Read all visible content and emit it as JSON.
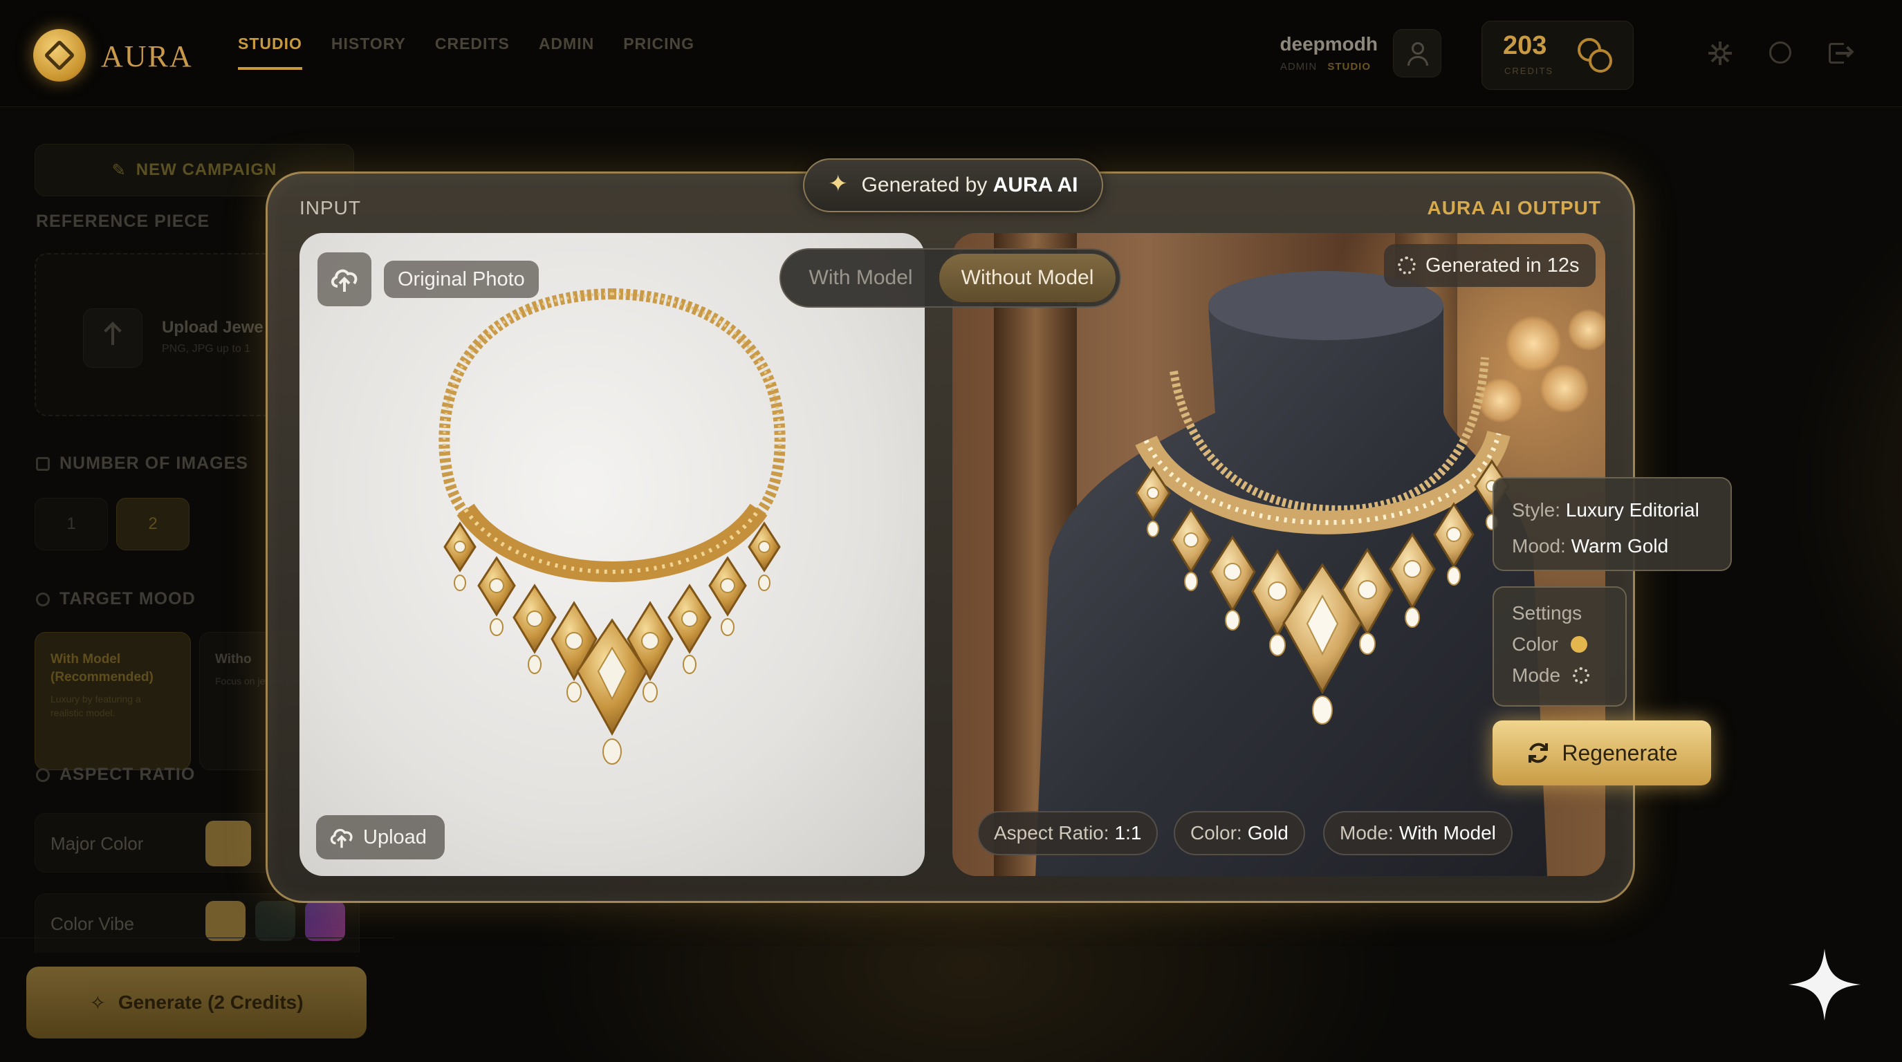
{
  "app": {
    "name": "AURA"
  },
  "nav": [
    {
      "label": "STUDIO",
      "active": true
    },
    {
      "label": "HISTORY",
      "active": false
    },
    {
      "label": "CREDITS",
      "active": false
    },
    {
      "label": "ADMIN",
      "active": false
    },
    {
      "label": "PRICING",
      "active": false
    }
  ],
  "user": {
    "name": "deepmodh",
    "role": "ADMIN",
    "plan": "STUDIO"
  },
  "credits": {
    "count": "203",
    "label": "CREDITS"
  },
  "sidebar": {
    "new_campaign": "NEW CAMPAIGN",
    "reference_label": "REFERENCE PIECE",
    "upload_title": "Upload Jewe",
    "upload_sub": "PNG, JPG up to 1",
    "number_label": "NUMBER OF IMAGES",
    "numbers": [
      "1",
      "2"
    ],
    "selected_number": "2",
    "mood_label": "TARGET MOOD",
    "mood_options": [
      {
        "title": "With Model (Recommended)",
        "desc": "Luxury by featuring a realistic model."
      },
      {
        "title": "Witho",
        "desc": "Focus on jewelr photo"
      }
    ],
    "aspect_label": "ASPECT RATIO",
    "major_color_label": "Major Color",
    "color_vibe_label": "Color Vibe",
    "generate_button": "Generate (2 Credits)"
  },
  "panel": {
    "input_label": "INPUT",
    "output_label": "AURA AI OUTPUT",
    "badge_prefix": "Generated by ",
    "badge_brand": "AURA AI",
    "original_photo": "Original Photo",
    "upload": "Upload",
    "toggle": {
      "options": [
        "With Model",
        "Without Model"
      ],
      "selected": "Without Model"
    },
    "generated_time": "Generated in 12s",
    "chips": [
      {
        "key": "Aspect Ratio:",
        "value": "1:1"
      },
      {
        "key": "Color:",
        "value": "Gold"
      },
      {
        "key": "Mode:",
        "value": "With Model"
      }
    ]
  },
  "style_card": {
    "style_key": "Style:",
    "style_value": "Luxury Editorial",
    "mood_key": "Mood:",
    "mood_value": "Warm Gold"
  },
  "settings_card": {
    "title": "Settings",
    "color_label": "Color",
    "mode_label": "Mode",
    "color_value_hex": "#e3b64e"
  },
  "regenerate": "Regenerate",
  "colors": {
    "accent_gold": "#c99a3c",
    "panel_border": "#cdaa64",
    "regen_gold": "#e6c06a"
  }
}
